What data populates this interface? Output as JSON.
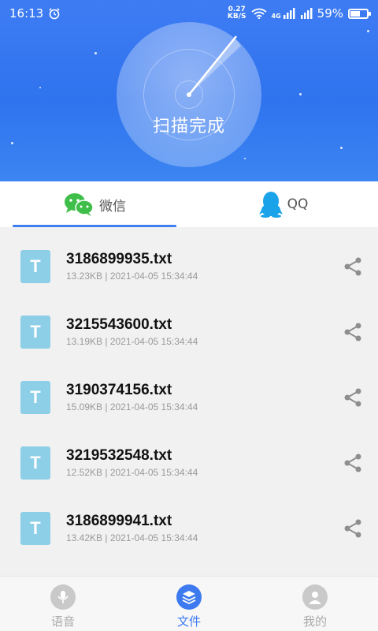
{
  "status_bar": {
    "time": "16:13",
    "net_speed_value": "0.27",
    "net_speed_unit": "KB/S",
    "network_4g": "4G",
    "battery_percent": "59%",
    "battery_level": 0.59
  },
  "header": {
    "scan_status": "扫描完成"
  },
  "tabs": [
    {
      "label": "微信",
      "icon": "wechat-icon",
      "active": true
    },
    {
      "label": "QQ",
      "icon": "qq-icon",
      "active": false
    }
  ],
  "files": [
    {
      "name": "3186899935.txt",
      "meta": "13.23KB | 2021-04-05 15:34:44",
      "icon_letter": "T"
    },
    {
      "name": "3215543600.txt",
      "meta": "13.19KB | 2021-04-05 15:34:44",
      "icon_letter": "T"
    },
    {
      "name": "3190374156.txt",
      "meta": "15.09KB | 2021-04-05 15:34:44",
      "icon_letter": "T"
    },
    {
      "name": "3219532548.txt",
      "meta": "12.52KB | 2021-04-05 15:34:44",
      "icon_letter": "T"
    },
    {
      "name": "3186899941.txt",
      "meta": "13.42KB | 2021-04-05 15:34:44",
      "icon_letter": "T"
    }
  ],
  "bottom_nav": [
    {
      "label": "语音",
      "icon": "microphone-icon",
      "active": false
    },
    {
      "label": "文件",
      "icon": "layers-icon",
      "active": true
    },
    {
      "label": "我的",
      "icon": "user-icon",
      "active": false
    }
  ],
  "colors": {
    "header_blue": "#2f73ee",
    "accent": "#3d7af0",
    "file_icon": "#8ecfe8",
    "wechat_green": "#3fbf4a",
    "qq_blue": "#1aa3e8"
  }
}
